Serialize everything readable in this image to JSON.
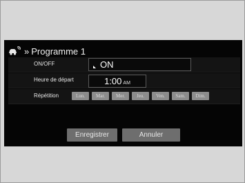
{
  "header": {
    "icon": "car-key-icon",
    "breadcrumb_icon": "double-chevron-right-icon",
    "chevron": "»",
    "title": "Programme 1"
  },
  "settings": {
    "onoff": {
      "label": "ON/OFF",
      "value": "ON"
    },
    "departure": {
      "label": "Heure de départ",
      "time": "1:00",
      "period": "AM"
    },
    "repetition": {
      "label": "Répétition",
      "days": [
        "Lun.",
        "Mar.",
        "Mer.",
        "Jeu.",
        "Ven.",
        "Sam.",
        "Dim."
      ]
    }
  },
  "actions": {
    "save_label": "Enregistrer",
    "cancel_label": "Annuler"
  },
  "colors": {
    "screen_bg": "#050505",
    "day_button": "#8c8c8c",
    "action_button": "#6e6e6e",
    "outer_bg": "#d7d7d7"
  }
}
